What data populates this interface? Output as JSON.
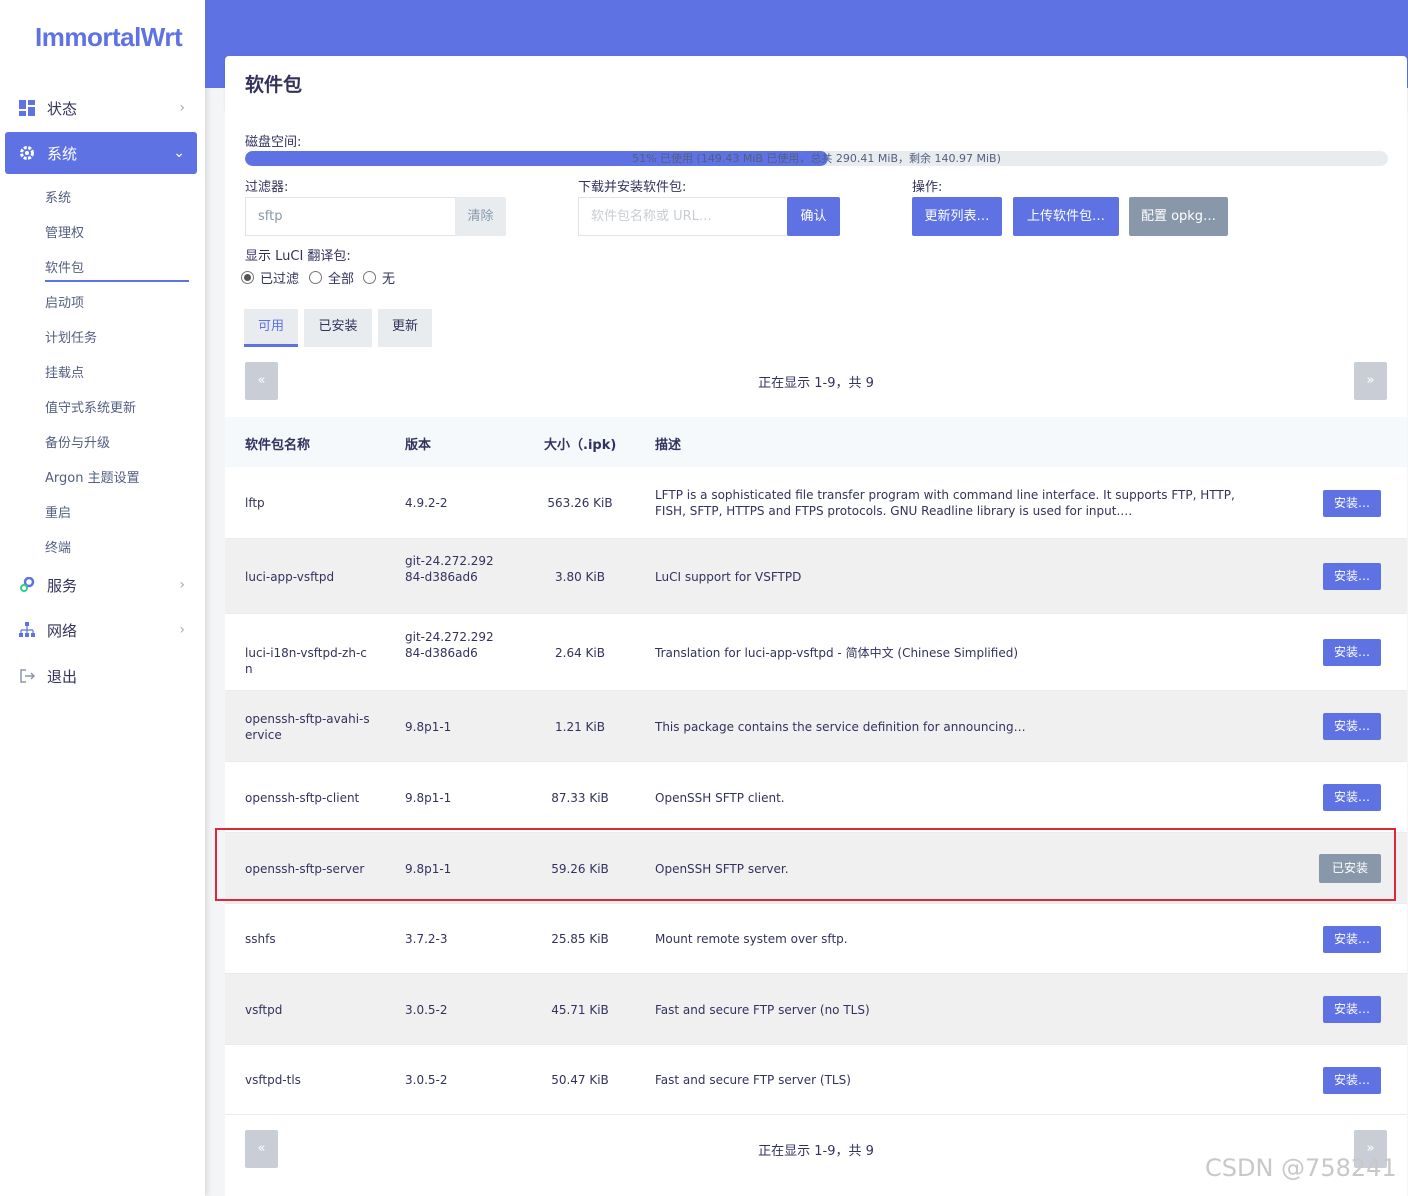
{
  "app": {
    "logo": "ImmortalWrt"
  },
  "sidebar": {
    "top": [
      {
        "label": "状态",
        "icon": "dashboard-icon"
      },
      {
        "label": "系统",
        "icon": "gear-icon"
      },
      {
        "label": "服务",
        "icon": "services-icon"
      },
      {
        "label": "网络",
        "icon": "network-icon"
      },
      {
        "label": "退出",
        "icon": "logout-icon"
      }
    ],
    "sub": [
      "系统",
      "管理权",
      "软件包",
      "启动项",
      "计划任务",
      "挂载点",
      "值守式系统更新",
      "备份与升级",
      "Argon 主题设置",
      "重启",
      "终端"
    ]
  },
  "page": {
    "title": "软件包"
  },
  "disk": {
    "label": "磁盘空间:",
    "used_fraction": 0.51,
    "text": "51% 已使用 (149.43 MiB 已使用，总共 290.41 MiB，剩余 140.97 MiB)"
  },
  "filter": {
    "label": "过滤器:",
    "value": "sftp",
    "clear": "清除"
  },
  "download": {
    "label": "下载并安装软件包:",
    "placeholder": "软件包名称或 URL…",
    "confirm": "确认"
  },
  "actions": {
    "label": "操作:",
    "update": "更新列表…",
    "upload": "上传软件包…",
    "config": "配置 opkg…"
  },
  "luci": {
    "label": "显示 LuCI 翻译包:",
    "options": [
      "已过滤",
      "全部",
      "无"
    ],
    "selected": 0
  },
  "tabs": [
    "可用",
    "已安装",
    "更新"
  ],
  "pager": {
    "prev": "«",
    "next": "»",
    "text": "正在显示 1-9，共 9"
  },
  "table": {
    "headers": [
      "软件包名称",
      "版本",
      "大小（.ipk)",
      "描述"
    ],
    "install_label": "安装…",
    "installed_label": "已安装",
    "rows": [
      {
        "name": "lftp",
        "version": "4.9.2-2",
        "size": "563.26 KiB",
        "desc": "LFTP is a sophisticated file transfer program with command line interface. It supports FTP, HTTP, FISH, SFTP, HTTPS and FTPS protocols. GNU Readline library is used for input.…",
        "installed": false
      },
      {
        "name": "luci-app-vsftpd",
        "version": "git-24.272.29284-d386ad6",
        "size": "3.80 KiB",
        "desc": "LuCI support for VSFTPD",
        "installed": false
      },
      {
        "name": "luci-i18n-vsftpd-zh-cn",
        "version": "git-24.272.29284-d386ad6",
        "size": "2.64 KiB",
        "desc": "Translation for luci-app-vsftpd - 简体中文 (Chinese Simplified)",
        "installed": false
      },
      {
        "name": "openssh-sftp-avahi-service",
        "version": "9.8p1-1",
        "size": "1.21 KiB",
        "desc": "This package contains the service definition for announcing…",
        "installed": false
      },
      {
        "name": "openssh-sftp-client",
        "version": "9.8p1-1",
        "size": "87.33 KiB",
        "desc": "OpenSSH SFTP client.",
        "installed": false
      },
      {
        "name": "openssh-sftp-server",
        "version": "9.8p1-1",
        "size": "59.26 KiB",
        "desc": "OpenSSH SFTP server.",
        "installed": true
      },
      {
        "name": "sshfs",
        "version": "3.7.2-3",
        "size": "25.85 KiB",
        "desc": "Mount remote system over sftp.",
        "installed": false
      },
      {
        "name": "vsftpd",
        "version": "3.0.5-2",
        "size": "45.71 KiB",
        "desc": "Fast and secure FTP server (no TLS)",
        "installed": false
      },
      {
        "name": "vsftpd-tls",
        "version": "3.0.5-2",
        "size": "50.47 KiB",
        "desc": "Fast and secure FTP server (TLS)",
        "installed": false
      }
    ]
  },
  "watermark": "CSDN @758241",
  "colors": {
    "accent": "#5e72e4",
    "highlight": "#e0263a"
  }
}
